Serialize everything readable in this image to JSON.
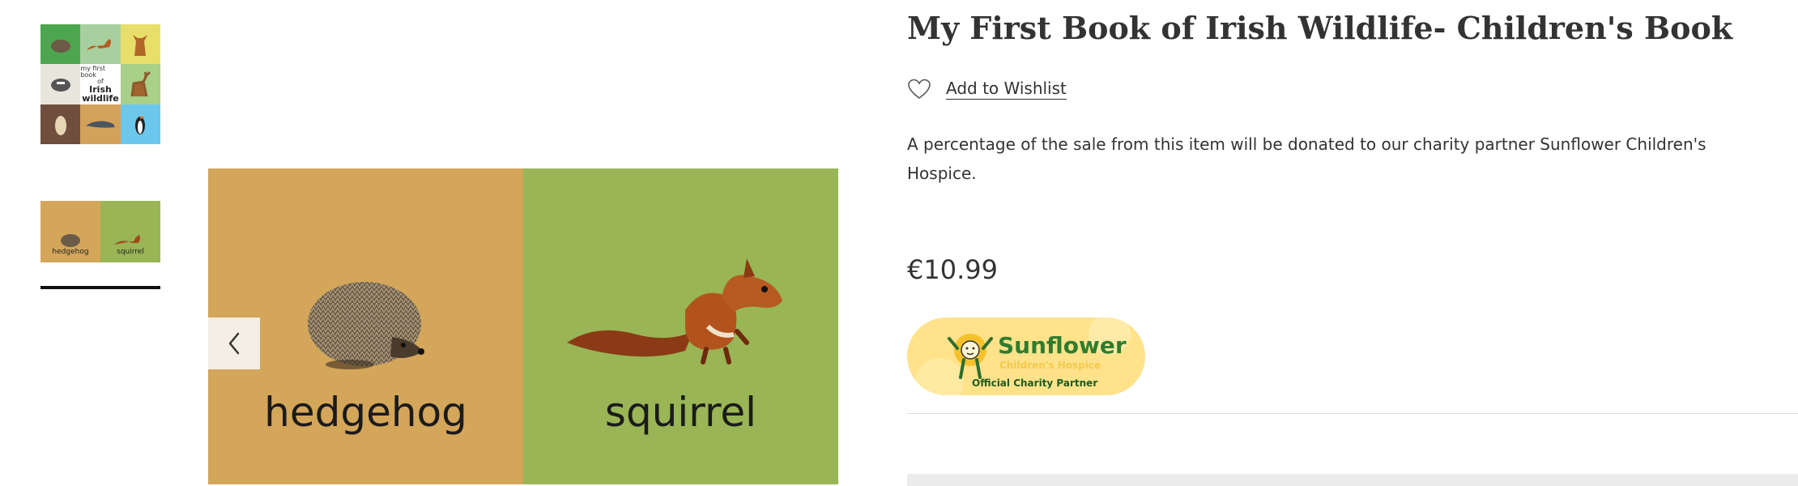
{
  "gallery": {
    "thumbnails": [
      {
        "name": "cover",
        "cover_text_small_1": "my first book",
        "cover_text_small_2": "of",
        "cover_text_big_1": "Irish",
        "cover_text_big_2": "wildlife"
      },
      {
        "name": "hedgehog-squirrel-spread",
        "left_label": "hedgehog",
        "right_label": "squirrel"
      }
    ],
    "main": {
      "left_label": "hedgehog",
      "right_label": "squirrel",
      "left_color": "#d3a65a",
      "right_color": "#99b556"
    },
    "prev_icon": "chevron-left-icon"
  },
  "product": {
    "title": "My First Book of Irish Wildlife- Children's Book",
    "wishlist_label": "Add to Wishlist",
    "wishlist_icon": "heart-outline-icon",
    "charity_text": "A percentage of the sale from this item will be donated to our charity partner Sunflower Children's Hospice.",
    "price": "€10.99"
  },
  "charity_badge": {
    "brand": "Sunflower",
    "subtitle": "Children's Hospice",
    "partner_text": "Official Charity Partner",
    "background": "#ffe28a",
    "brand_color": "#2e7d2e"
  }
}
